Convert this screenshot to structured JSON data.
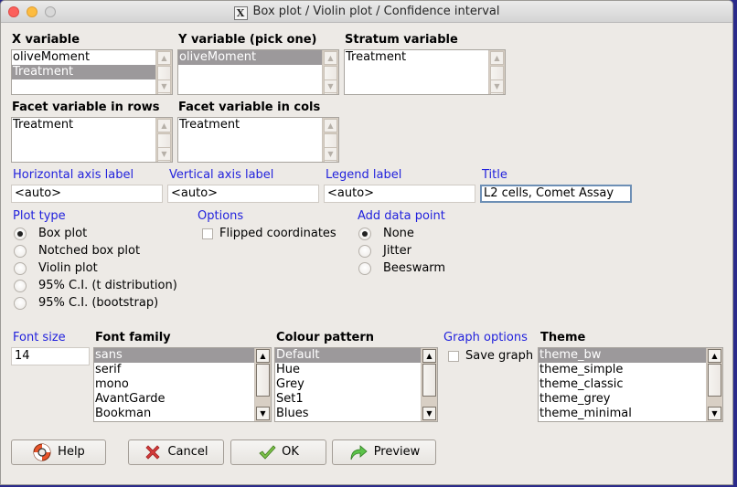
{
  "window": {
    "title": "Box plot / Violin plot / Confidence interval",
    "app_icon": "x11-icon"
  },
  "x_variable": {
    "label": "X variable",
    "items": [
      "oliveMoment",
      "Treatment"
    ],
    "selected": "Treatment"
  },
  "y_variable": {
    "label": "Y variable (pick one)",
    "items": [
      "oliveMoment"
    ],
    "selected": "oliveMoment"
  },
  "stratum_variable": {
    "label": "Stratum variable",
    "items": [
      "Treatment"
    ]
  },
  "facet_rows": {
    "label": "Facet variable in rows",
    "items": [
      "Treatment"
    ]
  },
  "facet_cols": {
    "label": "Facet variable in cols",
    "items": [
      "Treatment"
    ]
  },
  "labels": {
    "horizontal": {
      "label": "Horizontal axis label",
      "value": "<auto>"
    },
    "vertical": {
      "label": "Vertical axis label",
      "value": "<auto>"
    },
    "legend": {
      "label": "Legend label",
      "value": "<auto>"
    },
    "title": {
      "label": "Title",
      "value": "L2 cells, Comet Assay"
    }
  },
  "plot_type": {
    "label": "Plot type",
    "options": [
      "Box plot",
      "Notched box plot",
      "Violin plot",
      "95% C.I. (t distribution)",
      "95% C.I. (bootstrap)"
    ],
    "selected": "Box plot"
  },
  "options": {
    "label": "Options",
    "flipped_coordinates": {
      "label": "Flipped coordinates",
      "checked": false
    }
  },
  "add_data_point": {
    "label": "Add data point",
    "options": [
      "None",
      "Jitter",
      "Beeswarm"
    ],
    "selected": "None"
  },
  "font_size": {
    "label": "Font size",
    "value": "14"
  },
  "font_family": {
    "label": "Font family",
    "items": [
      "sans",
      "serif",
      "mono",
      "AvantGarde",
      "Bookman"
    ],
    "selected": "sans"
  },
  "colour_pattern": {
    "label": "Colour pattern",
    "items": [
      "Default",
      "Hue",
      "Grey",
      "Set1",
      "Blues"
    ],
    "selected": "Default"
  },
  "graph_options": {
    "label": "Graph options",
    "save_graph": {
      "label": "Save graph",
      "checked": false
    }
  },
  "theme": {
    "label": "Theme",
    "items": [
      "theme_bw",
      "theme_simple",
      "theme_classic",
      "theme_grey",
      "theme_minimal"
    ],
    "selected": "theme_bw"
  },
  "buttons": {
    "help": "Help",
    "cancel": "Cancel",
    "ok": "OK",
    "preview": "Preview"
  },
  "colors": {
    "section_label": "#2222dd",
    "selection": "#9c999b",
    "window_bg": "#edeae6"
  }
}
